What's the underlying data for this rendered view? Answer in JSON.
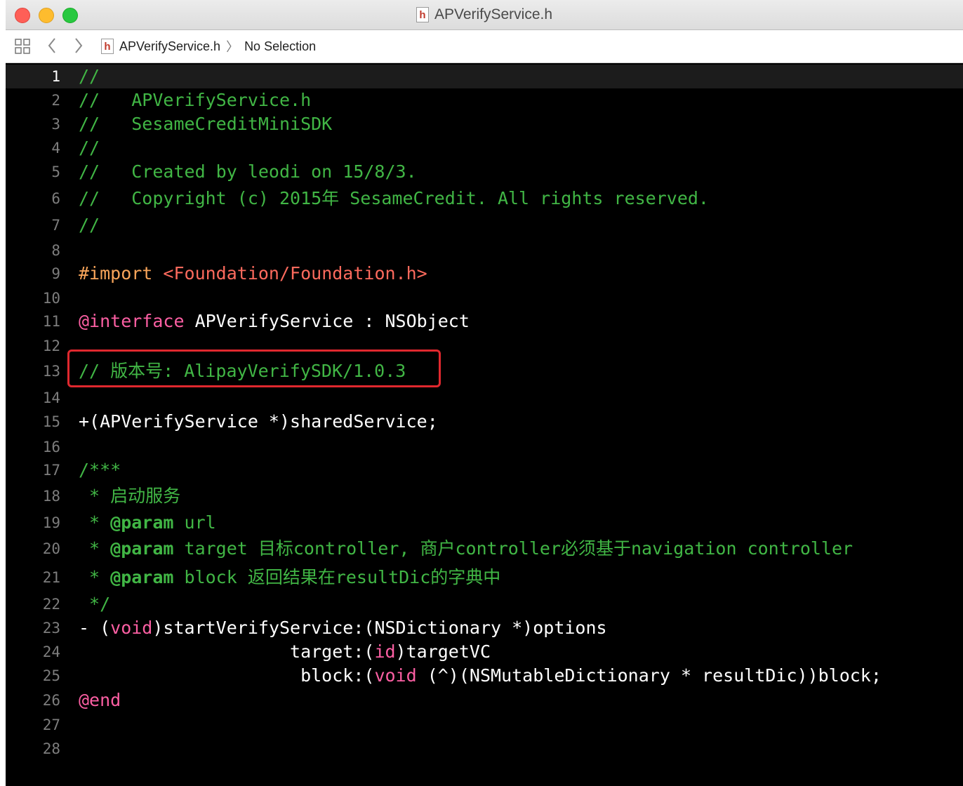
{
  "window": {
    "title": "APVerifyService.h",
    "file_icon_glyph": "h"
  },
  "jumpbar": {
    "file_icon_glyph": "h",
    "file_name": "APVerifyService.h",
    "separator": "〉",
    "selection": "No Selection"
  },
  "editor": {
    "current_line": 1,
    "line_numbers": [
      "1",
      "2",
      "3",
      "4",
      "5",
      "6",
      "7",
      "8",
      "9",
      "10",
      "11",
      "12",
      "13",
      "14",
      "15",
      "16",
      "17",
      "18",
      "19",
      "20",
      "21",
      "22",
      "23",
      "24",
      "25",
      "26",
      "27",
      "28"
    ],
    "lines": {
      "l1": {
        "a": "//"
      },
      "l2": {
        "a": "//   APVerifyService.h"
      },
      "l3": {
        "a": "//   SesameCreditMiniSDK"
      },
      "l4": {
        "a": "//"
      },
      "l5": {
        "a": "//   Created by leodi on 15/8/3."
      },
      "l6": {
        "a": "//   Copyright (c) 2015年 SesameCredit. All rights reserved."
      },
      "l7": {
        "a": "//"
      },
      "l9": {
        "a": "#import ",
        "b": "<Foundation/Foundation.h>"
      },
      "l11": {
        "a": "@interface",
        "b": " APVerifyService : NSObject"
      },
      "l13": {
        "a": "// 版本号: AlipayVerifySDK/1.0.3"
      },
      "l15": {
        "a": "+(APVerifyService *)sharedService;"
      },
      "l17": {
        "a": "/***"
      },
      "l18": {
        "a": " * 启动服务"
      },
      "l19": {
        "a": " * ",
        "b": "@param",
        "c": " url"
      },
      "l20": {
        "a": " * ",
        "b": "@param",
        "c": " target 目标controller, 商户controller必须基于navigation controller"
      },
      "l21": {
        "a": " * ",
        "b": "@param",
        "c": " block 返回结果在resultDic的字典中"
      },
      "l22": {
        "a": " */"
      },
      "l23": {
        "a": "- (",
        "b": "void",
        "c": ")startVerifyService:(NSDictionary *)options"
      },
      "l24": {
        "a": "                    target:(",
        "b": "id",
        "c": ")targetVC"
      },
      "l25": {
        "a": "                     block:(",
        "b": "void",
        "c": " (^)(NSMutableDictionary * resultDic))block;"
      },
      "l26": {
        "a": "@end"
      }
    }
  },
  "colors": {
    "comment": "#41b645",
    "preprocessor": "#f8a55a",
    "string": "#fc6a5d",
    "keyword": "#fc5fa3",
    "highlight_box": "#e0282e"
  }
}
